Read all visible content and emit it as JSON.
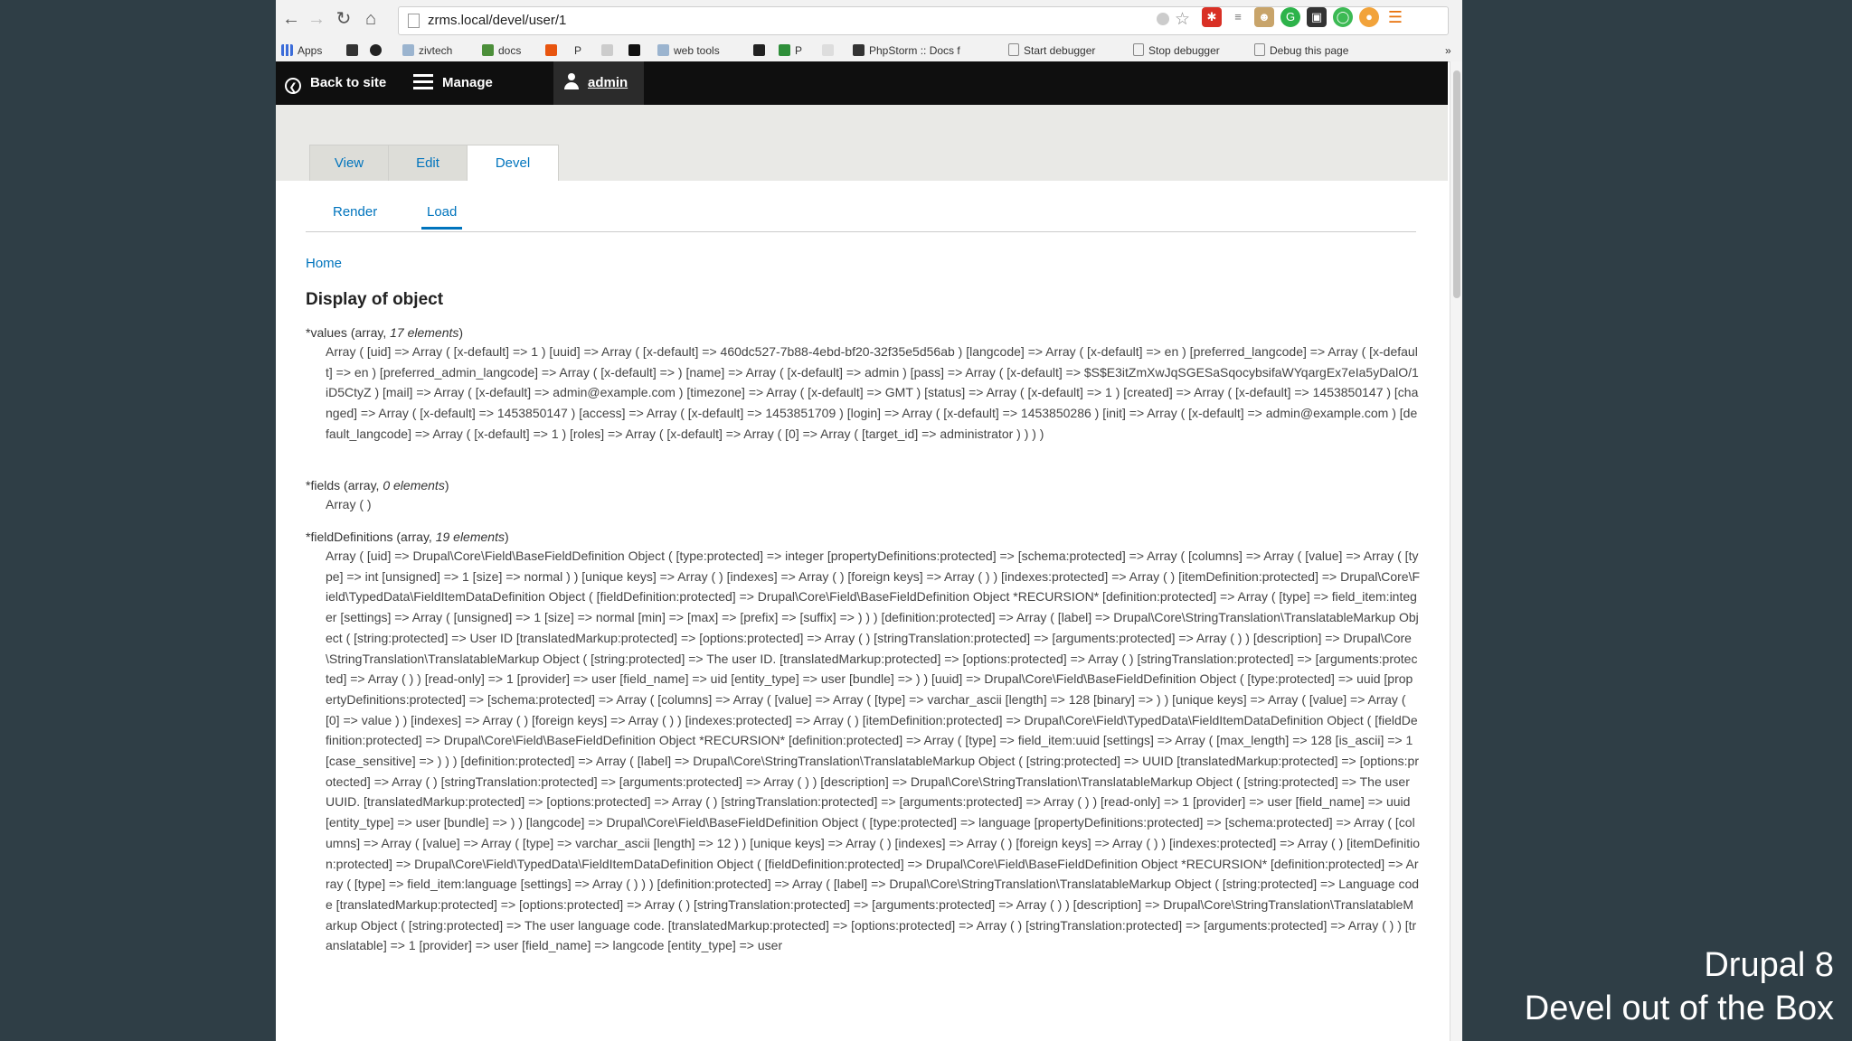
{
  "browser": {
    "url": "zrms.local/devel/user/1",
    "bookmarks": [
      {
        "label": "Apps"
      },
      {
        "label": ""
      },
      {
        "label": ""
      },
      {
        "label": "zivtech"
      },
      {
        "label": "docs"
      },
      {
        "label": ""
      },
      {
        "label": "P"
      },
      {
        "label": ""
      },
      {
        "label": ""
      },
      {
        "label": "web tools"
      },
      {
        "label": ""
      },
      {
        "label": "P"
      },
      {
        "label": ""
      },
      {
        "label": "PhpStorm :: Docs f"
      },
      {
        "label": "Start debugger"
      },
      {
        "label": "Stop debugger"
      },
      {
        "label": "Debug this page"
      }
    ],
    "bookmarks_more": "»"
  },
  "toolbar": {
    "back_label": "Back to site",
    "manage_label": "Manage",
    "user_label": "admin"
  },
  "tabs": [
    "View",
    "Edit",
    "Devel"
  ],
  "subtabs": [
    "Render",
    "Load"
  ],
  "breadcrumb": "Home",
  "page_title": "Display of object",
  "kint": {
    "values": {
      "name": "*values",
      "type": "(array, ",
      "count": "17 elements",
      "close": ")",
      "body": "Array ( [uid] => Array ( [x-default] => 1 ) [uuid] => Array ( [x-default] => 460dc527-7b88-4ebd-bf20-32f35e5d56ab ) [langcode] => Array ( [x-default] => en ) [preferred_langcode] => Array ( [x-default] => en ) [preferred_admin_langcode] => Array ( [x-default] => ) [name] => Array ( [x-default] => admin ) [pass] => Array ( [x-default] => $S$E3itZmXwJqSGESaSqocybsifaWYqargEx7eIa5yDalO/1iD5CtyZ ) [mail] => Array ( [x-default] => admin@example.com ) [timezone] => Array ( [x-default] => GMT ) [status] => Array ( [x-default] => 1 ) [created] => Array ( [x-default] => 1453850147 ) [changed] => Array ( [x-default] => 1453850147 ) [access] => Array ( [x-default] => 1453851709 ) [login] => Array ( [x-default] => 1453850286 ) [init] => Array ( [x-default] => admin@example.com ) [default_langcode] => Array ( [x-default] => 1 ) [roles] => Array ( [x-default] => Array ( [0] => Array ( [target_id] => administrator ) ) ) )"
    },
    "fields": {
      "name": "*fields",
      "type": "(array, ",
      "count": "0 elements",
      "close": ")",
      "body": "Array ( )"
    },
    "fieldDefinitions": {
      "name": "*fieldDefinitions",
      "type": "(array, ",
      "count": "19 elements",
      "close": ")",
      "body": "Array ( [uid] => Drupal\\Core\\Field\\BaseFieldDefinition Object ( [type:protected] => integer [propertyDefinitions:protected] => [schema:protected] => Array ( [columns] => Array ( [value] => Array ( [type] => int [unsigned] => 1 [size] => normal ) ) [unique keys] => Array ( ) [indexes] => Array ( ) [foreign keys] => Array ( ) ) [indexes:protected] => Array ( ) [itemDefinition:protected] => Drupal\\Core\\Field\\TypedData\\FieldItemDataDefinition Object ( [fieldDefinition:protected] => Drupal\\Core\\Field\\BaseFieldDefinition Object *RECURSION* [definition:protected] => Array ( [type] => field_item:integer [settings] => Array ( [unsigned] => 1 [size] => normal [min] => [max] => [prefix] => [suffix] => ) ) ) [definition:protected] => Array ( [label] => Drupal\\Core\\StringTranslation\\TranslatableMarkup Object ( [string:protected] => User ID [translatedMarkup:protected] => [options:protected] => Array ( ) [stringTranslation:protected] => [arguments:protected] => Array ( ) ) [description] => Drupal\\Core\\StringTranslation\\TranslatableMarkup Object ( [string:protected] => The user ID. [translatedMarkup:protected] => [options:protected] => Array ( ) [stringTranslation:protected] => [arguments:protected] => Array ( ) ) [read-only] => 1 [provider] => user [field_name] => uid [entity_type] => user [bundle] => ) ) [uuid] => Drupal\\Core\\Field\\BaseFieldDefinition Object ( [type:protected] => uuid [propertyDefinitions:protected] => [schema:protected] => Array ( [columns] => Array ( [value] => Array ( [type] => varchar_ascii [length] => 128 [binary] => ) ) [unique keys] => Array ( [value] => Array ( [0] => value ) ) [indexes] => Array ( ) [foreign keys] => Array ( ) ) [indexes:protected] => Array ( ) [itemDefinition:protected] => Drupal\\Core\\Field\\TypedData\\FieldItemDataDefinition Object ( [fieldDefinition:protected] => Drupal\\Core\\Field\\BaseFieldDefinition Object *RECURSION* [definition:protected] => Array ( [type] => field_item:uuid [settings] => Array ( [max_length] => 128 [is_ascii] => 1 [case_sensitive] => ) ) ) [definition:protected] => Array ( [label] => Drupal\\Core\\StringTranslation\\TranslatableMarkup Object ( [string:protected] => UUID [translatedMarkup:protected] => [options:protected] => Array ( ) [stringTranslation:protected] => [arguments:protected] => Array ( ) ) [description] => Drupal\\Core\\StringTranslation\\TranslatableMarkup Object ( [string:protected] => The user UUID. [translatedMarkup:protected] => [options:protected] => Array ( ) [stringTranslation:protected] => [arguments:protected] => Array ( ) ) [read-only] => 1 [provider] => user [field_name] => uuid [entity_type] => user [bundle] => ) ) [langcode] => Drupal\\Core\\Field\\BaseFieldDefinition Object ( [type:protected] => language [propertyDefinitions:protected] => [schema:protected] => Array ( [columns] => Array ( [value] => Array ( [type] => varchar_ascii [length] => 12 ) ) [unique keys] => Array ( ) [indexes] => Array ( ) [foreign keys] => Array ( ) ) [indexes:protected] => Array ( ) [itemDefinition:protected] => Drupal\\Core\\Field\\TypedData\\FieldItemDataDefinition Object ( [fieldDefinition:protected] => Drupal\\Core\\Field\\BaseFieldDefinition Object *RECURSION* [definition:protected] => Array ( [type] => field_item:language [settings] => Array ( ) ) ) [definition:protected] => Array ( [label] => Drupal\\Core\\StringTranslation\\TranslatableMarkup Object ( [string:protected] => Language code [translatedMarkup:protected] => [options:protected] => Array ( ) [stringTranslation:protected] => [arguments:protected] => Array ( ) ) [description] => Drupal\\Core\\StringTranslation\\TranslatableMarkup Object ( [string:protected] => The user language code. [translatedMarkup:protected] => [options:protected] => Array ( ) [stringTranslation:protected] => [arguments:protected] => Array ( ) ) [translatable] => 1 [provider] => user [field_name] => langcode [entity_type] => user"
    }
  },
  "overlay": {
    "line1": "Drupal 8",
    "line2": "Devel out of the Box"
  },
  "colors": {
    "link": "#0074bd",
    "toolbar_bg": "#0f0f0f",
    "outer_bg": "#2f3e46"
  }
}
